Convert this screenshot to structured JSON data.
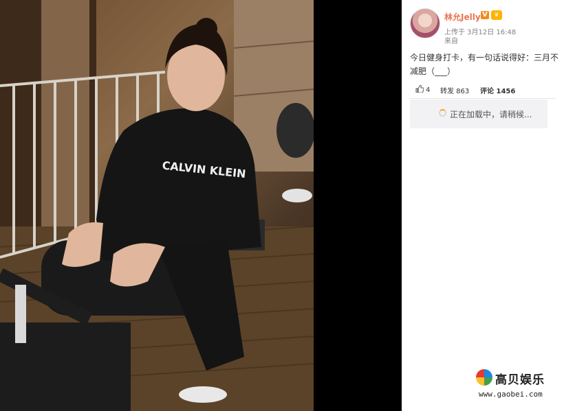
{
  "photo": {
    "description_icon": "gym-photo",
    "hoodie_text": "CALVIN KLEIN"
  },
  "post": {
    "username": "林允Jelly",
    "verified_badge": "V",
    "vip_badge": "vip-icon",
    "upload_time": "上传于 3月12日 16:48",
    "source": "来自",
    "text": "今日健身打卡，有一句话说得好：三月不减肥（___）"
  },
  "actions": {
    "like_count": "4",
    "repost_label": "转发 863",
    "comment_label": "评论 1456"
  },
  "loading": {
    "text": "正在加载中，请稍候..."
  },
  "watermark": {
    "title": "高贝娱乐",
    "url": "www.gaobei.com"
  },
  "colors": {
    "accent": "#eb7350",
    "background": "#000000",
    "panel": "#ffffff"
  }
}
